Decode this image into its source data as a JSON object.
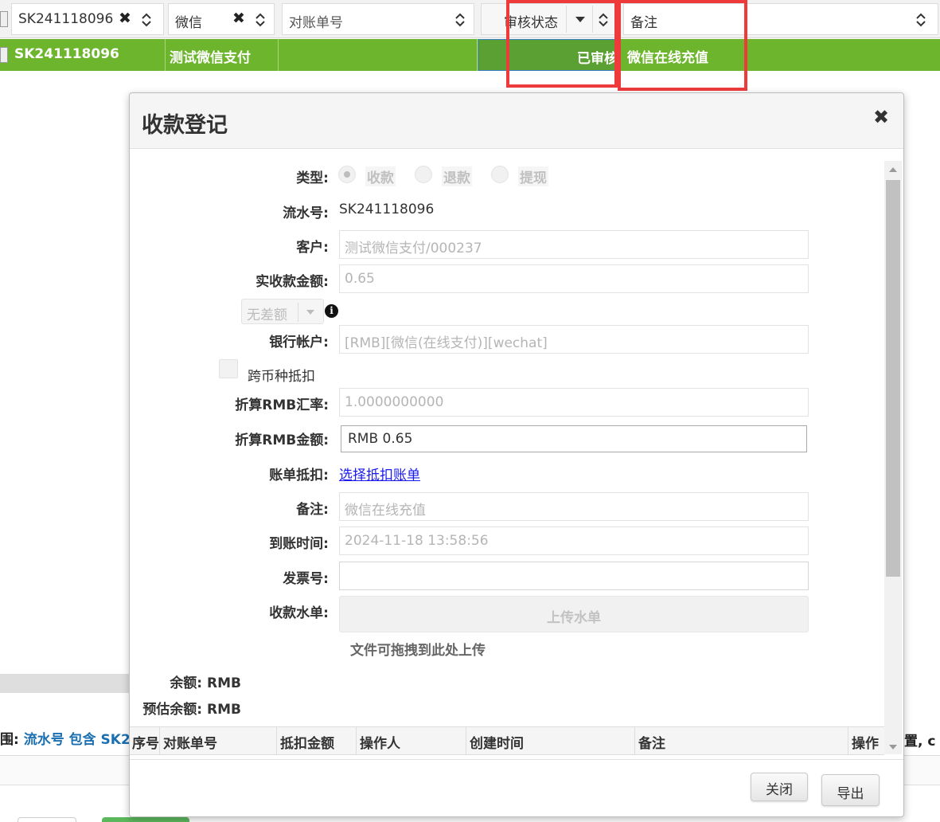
{
  "grid": {
    "filters": [
      {
        "value": "SK241118096"
      },
      {
        "value": "微信"
      },
      {
        "value": "对账单号"
      },
      {
        "value": "审核状态"
      },
      {
        "value": "备注"
      }
    ],
    "row": {
      "serial": "SK241118096",
      "customer": "测试微信支付",
      "statement": "",
      "status": "已审核",
      "remark": "微信在线充值"
    },
    "filter_info_prefix": "围: ",
    "filter_info_value": "流水号 包含 SK2",
    "filter_info_suffix": "置, c"
  },
  "modal": {
    "title": "收款登记",
    "close_icon": "close-icon",
    "type_label": "类型:",
    "type_options": [
      "收款",
      "退款",
      "提现"
    ],
    "type_selected": "收款",
    "serial_label": "流水号:",
    "serial_value": "SK241118096",
    "customer_label": "客户:",
    "customer_value": "测试微信支付/000237",
    "amount_label": "实收款金额:",
    "amount_value": "0.65",
    "diff_value": "无差额",
    "account_label": "银行帐户:",
    "account_value": "[RMB][微信(在线支付)][wechat]",
    "cross_currency_label": "跨币种抵扣",
    "rate_label": "折算RMB汇率:",
    "rate_value": "1.0000000000",
    "rmb_amount_label": "折算RMB金额:",
    "rmb_amount_value": "RMB 0.65",
    "bill_label": "账单抵扣:",
    "bill_link": "选择抵扣账单",
    "remark_label": "备注:",
    "remark_value": "微信在线充值",
    "arrival_label": "到账时间:",
    "arrival_value": "2024-11-18 13:58:56",
    "invoice_label": "发票号:",
    "invoice_value": "",
    "slip_label": "收款水单:",
    "upload_label": "上传水单",
    "upload_hint": "文件可拖拽到此处上传",
    "balance": "余额: RMB",
    "est_balance": "预估余额: RMB",
    "table_headers": [
      "序号",
      "对账单号",
      "抵扣金额",
      "操作人",
      "创建时间",
      "备注",
      "操作"
    ],
    "close_btn": "关闭",
    "export_btn": "导出"
  }
}
